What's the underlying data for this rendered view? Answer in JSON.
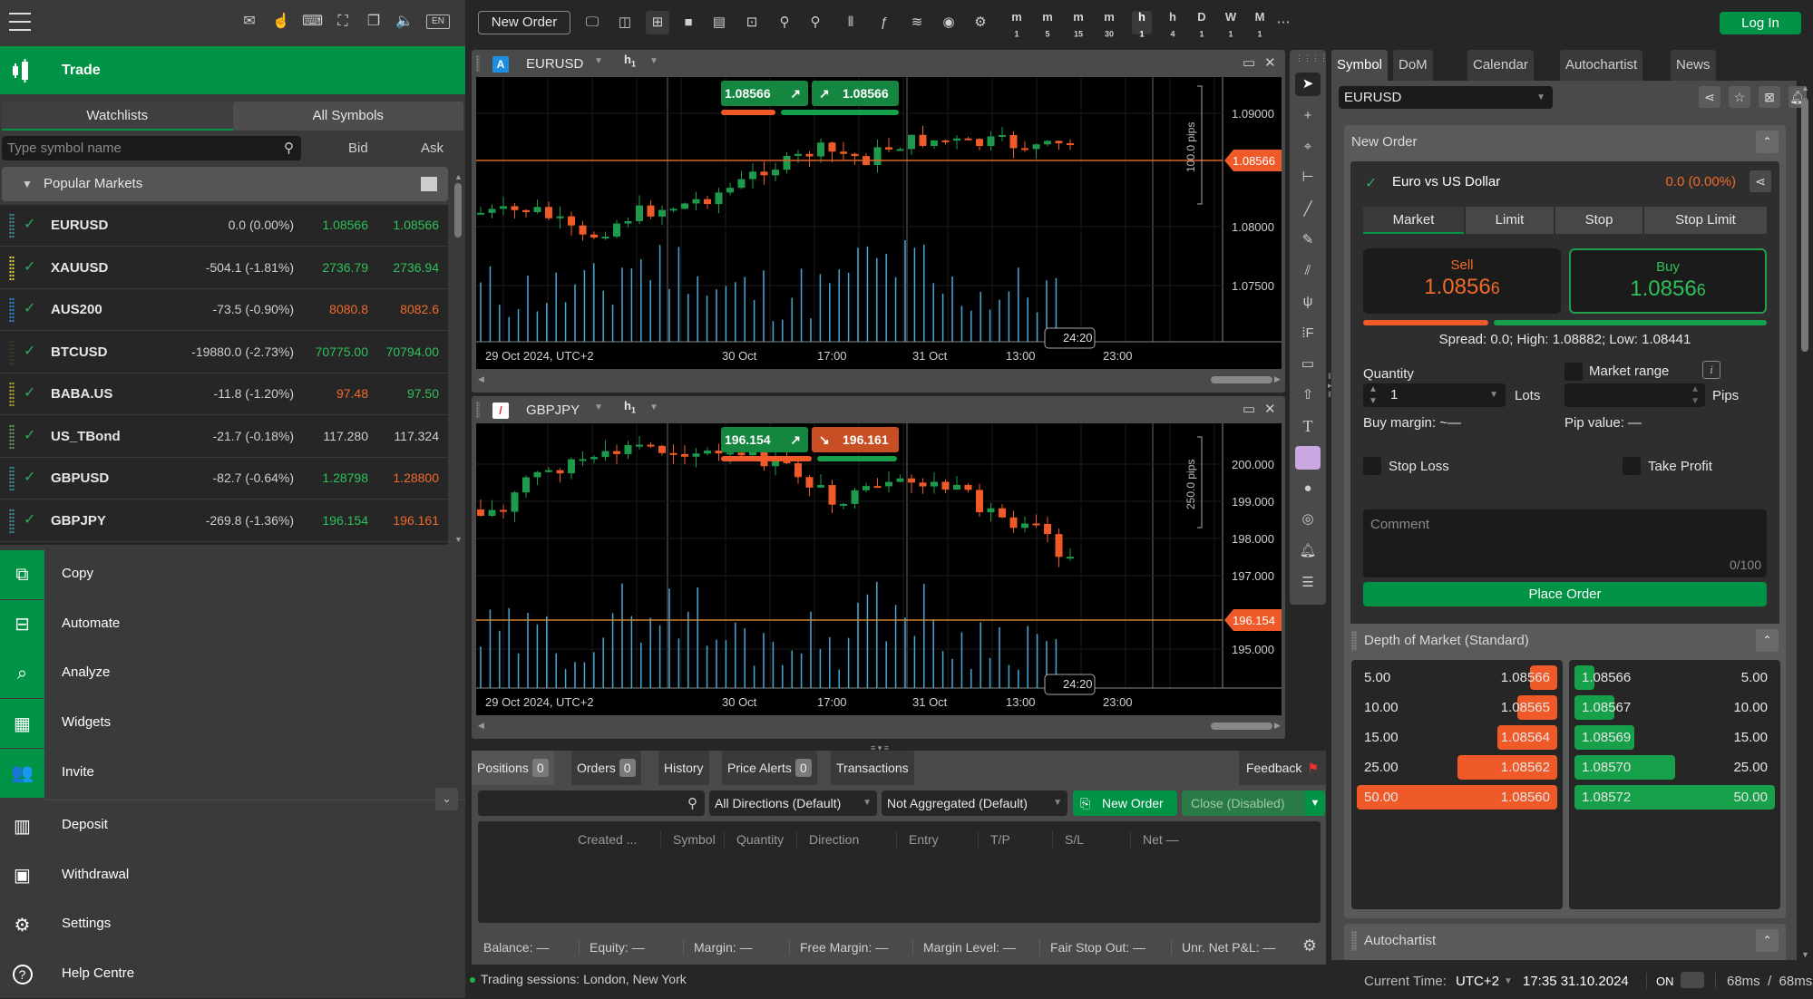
{
  "top_icons": {
    "menu": "menu-icon",
    "items": [
      "mail-icon",
      "touch-settings-icon",
      "keyboard-icon",
      "fullscreen-icon",
      "windows-icon",
      "sound-icon"
    ],
    "language": "EN"
  },
  "sidebar": {
    "active_section": "Trade",
    "watchlist_tabs": [
      "Watchlists",
      "All Symbols"
    ],
    "search_placeholder": "Type symbol name",
    "col_bid": "Bid",
    "col_ask": "Ask",
    "group_title": "Popular Markets",
    "symbols": [
      {
        "symbol": "EURUSD",
        "change": "0.0 (0.00%)",
        "bid": "1.08566",
        "ask": "1.08566",
        "bid_color": "g",
        "ask_color": "g",
        "grip": "#3c8a9e"
      },
      {
        "symbol": "XAUUSD",
        "change": "-504.1 (-1.81%)",
        "bid": "2736.79",
        "ask": "2736.94",
        "bid_color": "g",
        "ask_color": "g",
        "grip": "#d6c93a"
      },
      {
        "symbol": "AUS200",
        "change": "-73.5 (-0.90%)",
        "bid": "8080.8",
        "ask": "8082.6",
        "bid_color": "o",
        "ask_color": "o",
        "grip": "#2e7fd0"
      },
      {
        "symbol": "BTCUSD",
        "change": "-19880.0 (-2.73%)",
        "bid": "70775.00",
        "ask": "70794.00",
        "bid_color": "g",
        "ask_color": "g",
        "grip": "#3a3a2a"
      },
      {
        "symbol": "BABA.US",
        "change": "-11.8 (-1.20%)",
        "bid": "97.48",
        "ask": "97.50",
        "bid_color": "o",
        "ask_color": "g",
        "grip": "#a9a230"
      },
      {
        "symbol": "US_TBond",
        "change": "-21.7 (-0.18%)",
        "bid": "117.280",
        "ask": "117.324",
        "bid_color": "w",
        "ask_color": "w",
        "grip": "#5e9a55"
      },
      {
        "symbol": "GBPUSD",
        "change": "-82.7 (-0.64%)",
        "bid": "1.28798",
        "ask": "1.28800",
        "bid_color": "g",
        "ask_color": "o",
        "grip": "#3c8a9e"
      },
      {
        "symbol": "GBPJPY",
        "change": "-269.8 (-1.36%)",
        "bid": "196.154",
        "ask": "196.161",
        "bid_color": "g",
        "ask_color": "o",
        "grip": "#3c8a9e"
      }
    ],
    "nav_green": [
      {
        "label": "Copy",
        "icon": "copy-icon",
        "glyph": "⧉"
      },
      {
        "label": "Automate",
        "icon": "robot-icon",
        "glyph": "⊟"
      },
      {
        "label": "Analyze",
        "icon": "analyze-icon",
        "glyph": "⌕"
      },
      {
        "label": "Widgets",
        "icon": "widgets-icon",
        "glyph": "▦"
      },
      {
        "label": "Invite",
        "icon": "people-icon",
        "glyph": "👥"
      }
    ],
    "nav_plain": [
      {
        "label": "Deposit",
        "icon": "deposit-icon",
        "glyph": "▥"
      },
      {
        "label": "Withdrawal",
        "icon": "wallet-icon",
        "glyph": "▣"
      },
      {
        "label": "Settings",
        "icon": "gear-icon",
        "glyph": "⚙"
      },
      {
        "label": "Help Centre",
        "icon": "help-icon",
        "glyph": "?"
      }
    ]
  },
  "toolbar": {
    "new_order": "New Order",
    "timeframes": [
      {
        "l": "m",
        "s": "1"
      },
      {
        "l": "m",
        "s": "5"
      },
      {
        "l": "m",
        "s": "15"
      },
      {
        "l": "m",
        "s": "30"
      },
      {
        "l": "h",
        "s": "1"
      },
      {
        "l": "h",
        "s": "4"
      },
      {
        "l": "D",
        "s": "1"
      },
      {
        "l": "W",
        "s": "1"
      },
      {
        "l": "M",
        "s": "1"
      }
    ],
    "active_timeframe": "h1",
    "login": "Log In"
  },
  "charts": [
    {
      "symbol": "EURUSD",
      "badge": "A",
      "timeframe": "h",
      "timeframe_sub": "1",
      "sell_quote": "1.08566",
      "buy_quote": "1.08566",
      "current_price": "1.08566",
      "range_label": "100.0 pips",
      "countdown": "24:20",
      "y_ticks": [
        "1.09000",
        "1.08000",
        "1.07500"
      ],
      "x_ticks": [
        "29 Oct 2024, UTC+2",
        "30 Oct",
        "17:00",
        "31 Oct",
        "13:00",
        "23:00"
      ]
    },
    {
      "symbol": "GBPJPY",
      "badge": "/",
      "timeframe": "h",
      "timeframe_sub": "1",
      "sell_quote": "196.154",
      "buy_quote": "196.161",
      "current_price": "196.154",
      "range_label": "250.0 pips",
      "countdown": "24:20",
      "y_ticks": [
        "200.000",
        "199.000",
        "198.000",
        "197.000",
        "195.000"
      ],
      "x_ticks": [
        "29 Oct 2024, UTC+2",
        "30 Oct",
        "17:00",
        "31 Oct",
        "13:00",
        "23:00"
      ]
    }
  ],
  "bottom": {
    "tabs": [
      {
        "label": "Positions",
        "count": "0"
      },
      {
        "label": "Orders",
        "count": "0"
      },
      {
        "label": "History"
      },
      {
        "label": "Price Alerts",
        "count": "0"
      },
      {
        "label": "Transactions"
      }
    ],
    "feedback": "Feedback",
    "direction_filter": "All Directions (Default)",
    "aggregation_filter": "Not Aggregated (Default)",
    "new_order": "New Order",
    "close": "Close (Disabled)",
    "columns": [
      "Created ...",
      "Symbol",
      "Quantity",
      "Direction",
      "Entry",
      "T/P",
      "S/L",
      "Net —"
    ],
    "account": [
      "Balance: —",
      "Equity: —",
      "Margin: —",
      "Free Margin: —",
      "Margin Level: —",
      "Fair Stop Out: —",
      "Unr. Net P&L: —"
    ]
  },
  "status": {
    "sessions": "Trading sessions: London, New York",
    "current_time_label": "Current Time:",
    "timezone": "UTC+2",
    "datetime": "17:35 31.10.2024",
    "on": "ON",
    "latency": "68ms  /  68ms"
  },
  "right": {
    "tabs": [
      "Symbol",
      "DoM",
      "Calendar",
      "Autochartist",
      "News"
    ],
    "symbol": "EURUSD",
    "new_order": {
      "title": "New Order",
      "instrument": "Euro vs US Dollar",
      "change": "0.0 (0.00%)",
      "order_types": [
        "Market",
        "Limit",
        "Stop",
        "Stop Limit"
      ],
      "sell_label": "Sell",
      "sell_price": "1.0856",
      "sell_pip": "6",
      "buy_label": "Buy",
      "buy_price": "1.0856",
      "buy_pip": "6",
      "sell_ratio": 0.32,
      "spread": "Spread: 0.0; High: 1.08882; Low: 1.08441",
      "quantity_label": "Quantity",
      "quantity": "1",
      "lots": "Lots",
      "market_range": "Market range",
      "pips": "Pips",
      "buy_margin": "Buy margin: ~—",
      "pip_value": "Pip value: —",
      "stop_loss": "Stop Loss",
      "take_profit": "Take Profit",
      "comment_placeholder": "Comment",
      "comment_count": "0/100",
      "place_order": "Place Order"
    },
    "dom": {
      "title": "Depth of Market (Standard)",
      "bids": [
        {
          "vol": "5.00",
          "price": "1.08566",
          "fill": 0.1
        },
        {
          "vol": "10.00",
          "price": "1.08565",
          "fill": 0.2
        },
        {
          "vol": "15.00",
          "price": "1.08564",
          "fill": 0.3
        },
        {
          "vol": "25.00",
          "price": "1.08562",
          "fill": 0.5
        },
        {
          "vol": "50.00",
          "price": "1.08560",
          "fill": 1.0
        }
      ],
      "asks": [
        {
          "price": "1.08566",
          "vol": "5.00",
          "fill": 0.1
        },
        {
          "price": "1.08567",
          "vol": "10.00",
          "fill": 0.2
        },
        {
          "price": "1.08569",
          "vol": "15.00",
          "fill": 0.3
        },
        {
          "price": "1.08570",
          "vol": "25.00",
          "fill": 0.5
        },
        {
          "price": "1.08572",
          "vol": "50.00",
          "fill": 1.0
        }
      ]
    },
    "autochartist_title": "Autochartist"
  }
}
